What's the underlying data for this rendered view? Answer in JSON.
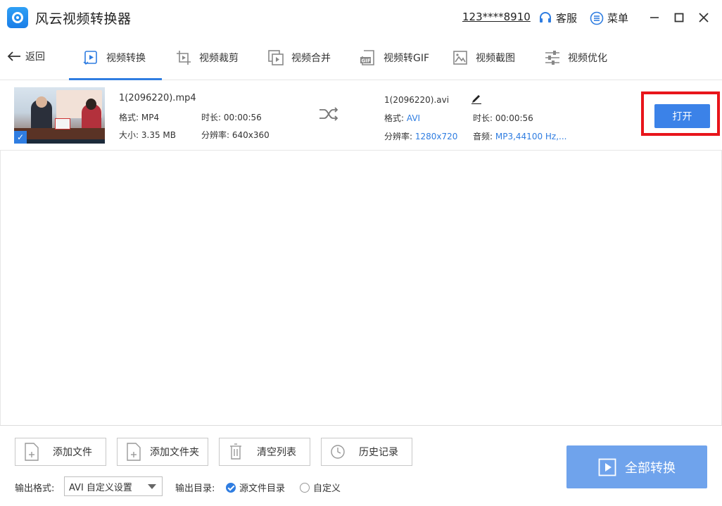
{
  "app": {
    "title": "风云视频转换器",
    "account": "123****8910",
    "service_label": "客服",
    "menu_label": "菜单"
  },
  "window": {
    "minimize_icon": "minimize-icon",
    "maximize_icon": "maximize-icon",
    "close_icon": "close-icon"
  },
  "nav": {
    "back_label": "返回",
    "tabs": [
      {
        "label": "视频转换",
        "icon": "video-convert-icon",
        "active": true
      },
      {
        "label": "视频裁剪",
        "icon": "video-crop-icon",
        "active": false
      },
      {
        "label": "视频合并",
        "icon": "video-merge-icon",
        "active": false
      },
      {
        "label": "视频转GIF",
        "icon": "gif-icon",
        "active": false
      },
      {
        "label": "视频截图",
        "icon": "screenshot-icon",
        "active": false
      },
      {
        "label": "视频优化",
        "icon": "optimize-icon",
        "active": false
      }
    ]
  },
  "file": {
    "source": {
      "name": "1(2096220).mp4",
      "format_label": "格式:",
      "format": "MP4",
      "duration_label": "时长:",
      "duration": "00:00:56",
      "size_label": "大小:",
      "size": "3.35 MB",
      "resolution_label": "分辨率:",
      "resolution": "640x360"
    },
    "output": {
      "name": "1(2096220).avi",
      "format_label": "格式:",
      "format": "AVI",
      "duration_label": "时长:",
      "duration": "00:00:56",
      "resolution_label": "分辨率:",
      "resolution": "1280x720",
      "audio_label": "音频:",
      "audio": "MP3,44100 Hz,..."
    },
    "open_label": "打开"
  },
  "bottom": {
    "add_file": "添加文件",
    "add_folder": "添加文件夹",
    "clear_list": "清空列表",
    "history": "历史记录",
    "convert_all": "全部转换",
    "output_format_label": "输出格式:",
    "output_format_value": "AVI 自定义设置",
    "output_dir_label": "输出目录:",
    "dir_source": "源文件目录",
    "dir_custom": "自定义"
  },
  "colors": {
    "accent": "#2f7de1",
    "highlight": "#e8151b",
    "convert_all_bg": "#6fa3ec"
  }
}
